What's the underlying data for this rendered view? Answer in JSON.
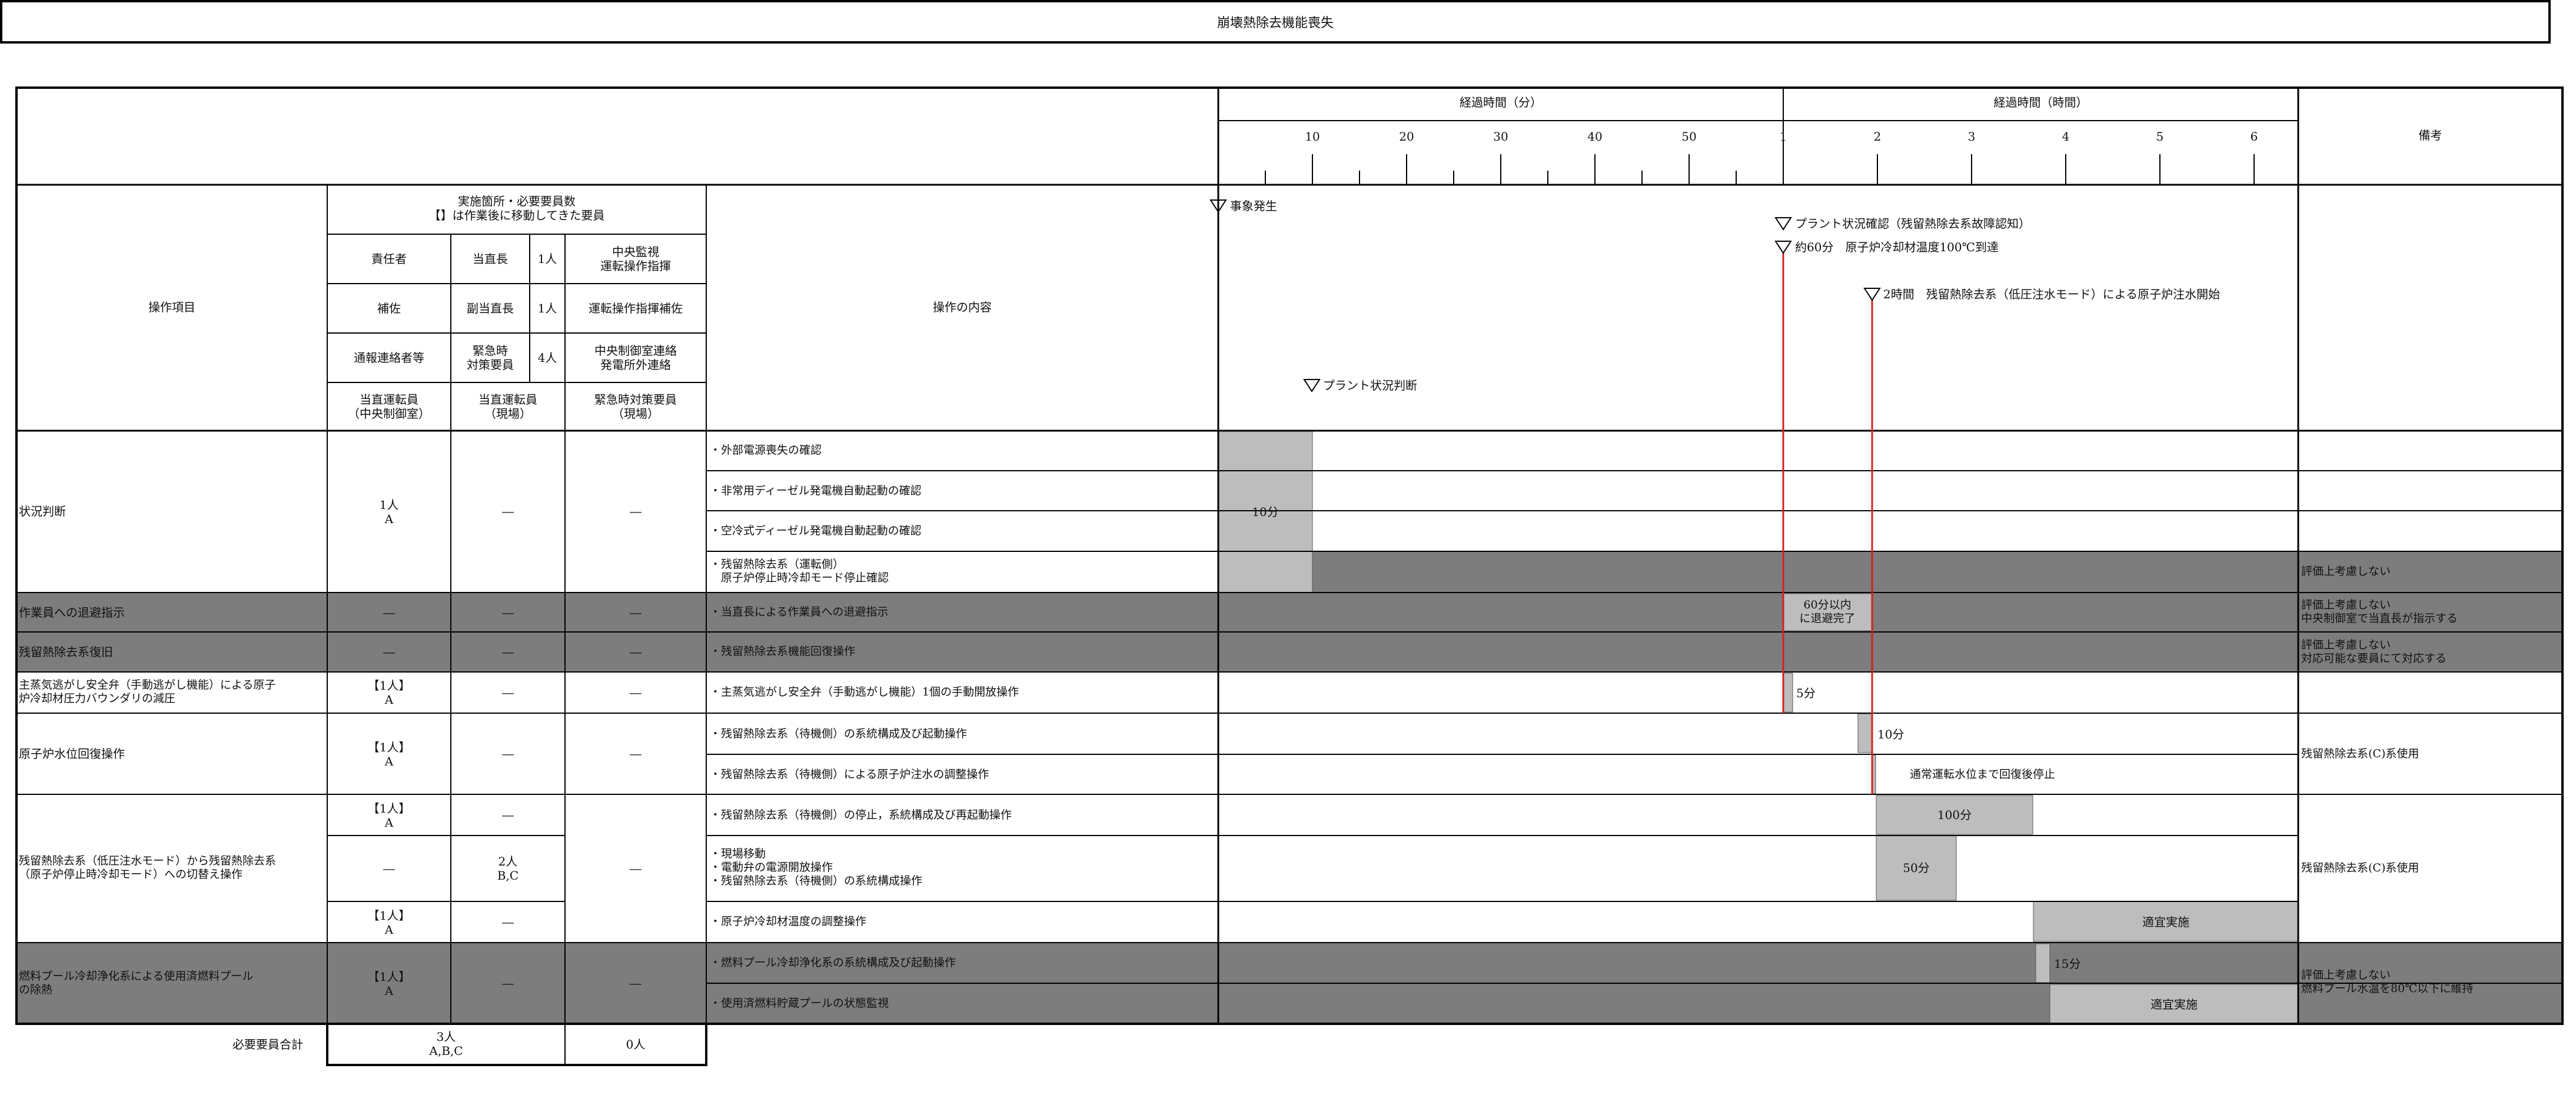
{
  "title": "崩壊熱除去機能喪失",
  "header": {
    "time_min_label": "経過時間（分）",
    "time_hr_label": "経過時間（時間）",
    "remarks_label": "備考",
    "ticks_min": [
      "10",
      "20",
      "30",
      "40",
      "50"
    ],
    "ticks_hr": [
      "1",
      "2",
      "3",
      "4",
      "5",
      "6"
    ]
  },
  "personnel_header": {
    "op_items_label": "操作項目",
    "op_content_label": "操作の内容",
    "staff_title": "実施箇所・必要要員数\n【】は作業後に移動してきた要員",
    "rows": [
      {
        "role": "責任者",
        "who": "当直長",
        "count": "1人",
        "duty": "中央監視\n運転操作指揮"
      },
      {
        "role": "補佐",
        "who": "副当直長",
        "count": "1人",
        "duty": "運転操作指揮補佐"
      },
      {
        "role": "通報連絡者等",
        "who": "緊急時\n対策要員",
        "count": "4人",
        "duty": "中央制御室連絡\n発電所外連絡"
      }
    ],
    "cols": [
      "当直運転員\n（中央制御室）",
      "当直運転員\n（現場）",
      "緊急時対策要員\n（現場）"
    ]
  },
  "events": [
    {
      "label": "事象発生"
    },
    {
      "label": "プラント状況判断"
    },
    {
      "label": "プラント状況確認（残留熱除去系故障認知）"
    },
    {
      "label": "約60分　原子炉冷却材温度100℃到達"
    },
    {
      "label": "2時間　残留熱除去系（低圧注水モード）による原子炉注水開始"
    }
  ],
  "groups": [
    {
      "item": "状況判断",
      "central": "1人\nA",
      "field": "―",
      "emergency": "―"
    },
    {
      "item": "作業員への退避指示",
      "central": "―",
      "field": "―",
      "emergency": "―",
      "remark": "評価上考慮しない\n中央制御室で当直長が指示する"
    },
    {
      "item": "残留熱除去系復旧",
      "central": "―",
      "field": "―",
      "emergency": "―",
      "remark": "評価上考慮しない\n対応可能な要員にて対応する"
    },
    {
      "item": "主蒸気逃がし安全弁（手動逃がし機能）による原子\n炉冷却材圧力バウンダリの減圧",
      "central": "【1人】\nA",
      "field": "―",
      "emergency": "―"
    },
    {
      "item": "原子炉水位回復操作",
      "central": "【1人】\nA",
      "field": "―",
      "emergency": "―",
      "remark": "残留熱除去系(C)系使用"
    },
    {
      "item": "残留熱除去系（低圧注水モード）から残留熱除去系\n（原子炉停止時冷却モード）への切替え操作",
      "central": [
        "【1人】\nA",
        "―",
        "【1人】\nA"
      ],
      "field": [
        "―",
        "2人\nB,C",
        "―"
      ],
      "emergency": "―",
      "remark": "残留熱除去系(C)系使用"
    },
    {
      "item": "燃料プール冷却浄化系による使用済燃料プール\nの除熱",
      "central": "【1人】\nA",
      "field": "―",
      "emergency": "―",
      "remark": "評価上考慮しない\n燃料プール水温を80℃以下に維持"
    }
  ],
  "operations": [
    "・外部電源喪失の確認",
    "・非常用ディーゼル発電機自動起動の確認",
    "・空冷式ディーゼル発電機自動起動の確認",
    "・残留熱除去系（運転側）\n　原子炉停止時冷却モード停止確認",
    "・当直長による作業員への退避指示",
    "・残留熱除去系機能回復操作",
    "・主蒸気逃がし安全弁（手動逃がし機能）1個の手動開放操作",
    "・残留熱除去系（待機側）の系統構成及び起動操作",
    "・残留熱除去系（待機側）による原子炉注水の調整操作",
    "・残留熱除去系（待機側）の停止，系統構成及び再起動操作",
    "・現場移動\n・電動弁の電源開放操作\n・残留熱除去系（待機側）の系統構成操作",
    "・原子炉冷却材温度の調整操作",
    "・燃料プール冷却浄化系の系統構成及び起動操作",
    "・使用済燃料貯蔵プールの状態監視"
  ],
  "row_remark_0": "評価上考慮しない",
  "bar_labels": {
    "b10": "10分",
    "b60": "60分以内\nに退避完了",
    "b5": "5分",
    "b10b": "10分",
    "bnote": "通常運転水位まで回復後停止",
    "b100": "100分",
    "b50": "50分",
    "bapp": "適宜実施",
    "b15": "15分",
    "bapp2": "適宜実施"
  },
  "footer": {
    "label": "必要要員合計",
    "central": "3人\nA,B,C",
    "emergency": "0人"
  },
  "colors": {
    "shade": "#7d7d7d",
    "bar": "#bdbdbd",
    "critical_line": "#d42020"
  }
}
